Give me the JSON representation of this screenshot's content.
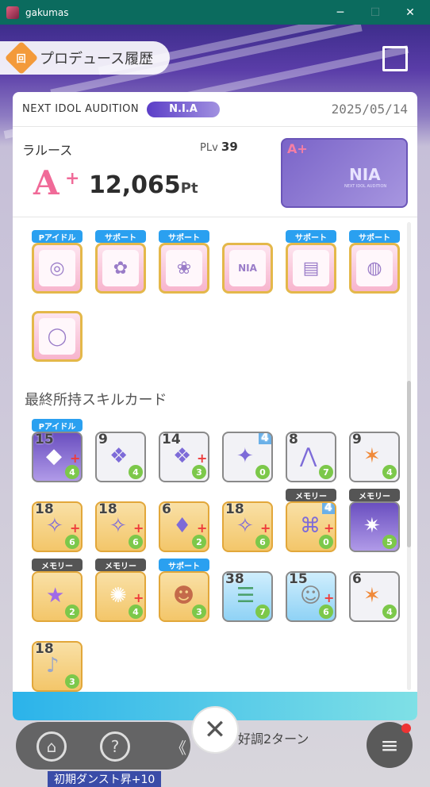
{
  "window": {
    "title": "gakumas",
    "min": "─",
    "max": "☐",
    "close": "✕"
  },
  "header": {
    "title": "プロデュース履歴",
    "icon_text": "回"
  },
  "card": {
    "audition_label": "NEXT IDOL AUDITION",
    "audition_badge": "N.I.A",
    "date": "2025/05/14",
    "idol_name": "ラルース",
    "plv_label": "PLv",
    "plv_value": "39",
    "rank": "A",
    "rank_plus": "+",
    "points_value": "12,065",
    "points_unit": "Pt",
    "banner_rank": "A+",
    "banner_logo": "NIA",
    "banner_sub": "NEXT IDOL AUDITION"
  },
  "items": [
    {
      "tag": "Pアイドル",
      "glyph": "◎"
    },
    {
      "tag": "サポート",
      "glyph": "✿"
    },
    {
      "tag": "サポート",
      "glyph": "❀"
    },
    {
      "tag": "",
      "glyph": "NIA"
    },
    {
      "tag": "サポート",
      "glyph": "▤"
    },
    {
      "tag": "サポート",
      "glyph": "◍"
    },
    {
      "tag": "",
      "glyph": "◯"
    }
  ],
  "skill_section_title": "最終所持スキルカード",
  "skills": [
    {
      "tag": "Pアイドル",
      "cost": "15",
      "plus": "+",
      "foot": "4"
    },
    {
      "tag": "",
      "cost": "9",
      "plus": "",
      "foot": "4"
    },
    {
      "tag": "",
      "cost": "14",
      "plus": "+",
      "foot": "3"
    },
    {
      "tag": "",
      "cost": "4",
      "plus": "",
      "foot": "0"
    },
    {
      "tag": "",
      "cost": "8",
      "plus": "",
      "foot": "7"
    },
    {
      "tag": "",
      "cost": "9",
      "plus": "",
      "foot": "4"
    },
    {
      "tag": "",
      "cost": "18",
      "plus": "+",
      "foot": "6"
    },
    {
      "tag": "",
      "cost": "18",
      "plus": "+",
      "foot": "6"
    },
    {
      "tag": "",
      "cost": "6",
      "plus": "+",
      "foot": "2"
    },
    {
      "tag": "",
      "cost": "18",
      "plus": "+",
      "foot": "6"
    },
    {
      "tag": "メモリー",
      "cost": "4",
      "plus": "+",
      "foot": "0"
    },
    {
      "tag": "メモリー",
      "cost": "",
      "plus": "",
      "foot": "5"
    },
    {
      "tag": "メモリー",
      "cost": "",
      "plus": "",
      "foot": "2"
    },
    {
      "tag": "メモリー",
      "cost": "",
      "plus": "+",
      "foot": "4"
    },
    {
      "tag": "サポート",
      "cost": "",
      "plus": "",
      "foot": "3"
    },
    {
      "tag": "",
      "cost": "38",
      "plus": "",
      "foot": "7"
    },
    {
      "tag": "",
      "cost": "15",
      "plus": "+",
      "foot": "6"
    },
    {
      "tag": "",
      "cost": "6",
      "plus": "",
      "foot": "4"
    },
    {
      "tag": "",
      "cost": "18",
      "plus": "",
      "foot": "3"
    }
  ],
  "close_label": "✕",
  "nav": {
    "home": "⌂",
    "help": "?",
    "back": "《",
    "menu": "≡"
  },
  "background_text": {
    "line1": "好調2ターン",
    "line2": "初期ダンスト昇+10"
  }
}
